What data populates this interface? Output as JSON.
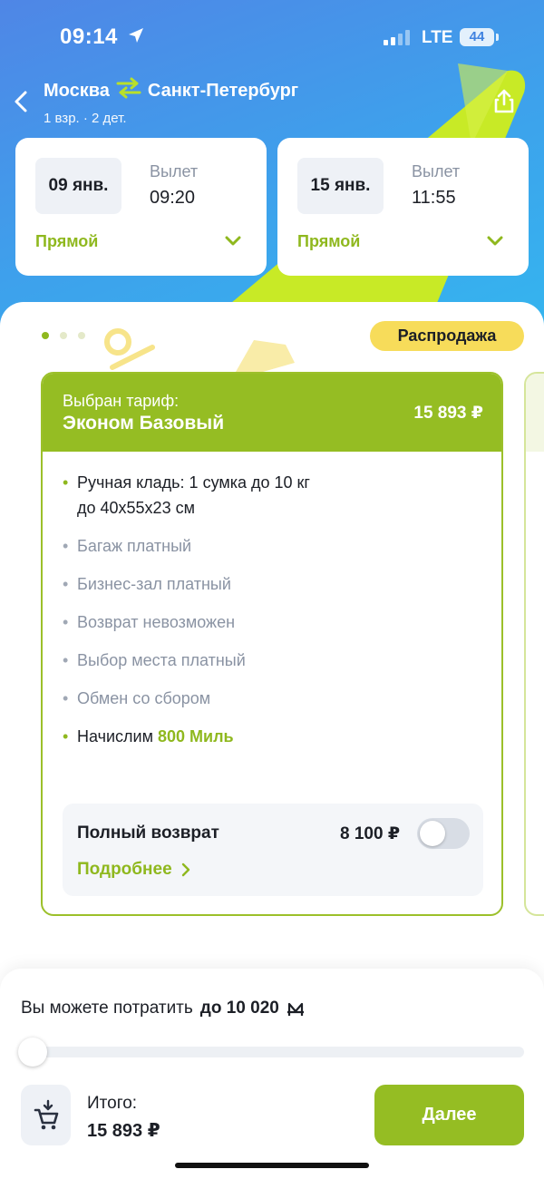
{
  "status_bar": {
    "time": "09:14",
    "network": "LTE",
    "battery": "44"
  },
  "header": {
    "from": "Москва",
    "to": "Санкт-Петербург",
    "passengers": "1 взр. · 2 дет."
  },
  "flights": [
    {
      "date": "09 янв.",
      "label": "Вылет",
      "time": "09:20",
      "type": "Прямой"
    },
    {
      "date": "15 янв.",
      "label": "Вылет",
      "time": "11:55",
      "type": "Прямой"
    }
  ],
  "carousel": {
    "page": 1,
    "total": 3
  },
  "sale_badge": "Распродажа",
  "tariff": {
    "selected_label": "Выбран тариф:",
    "name": "Эконом Базовый",
    "price": "15 893 ₽",
    "features": [
      {
        "line1": "Ручная кладь: 1 сумка до 10 кг",
        "line2": "до 40x55x23 см"
      },
      {
        "text": "Багаж платный"
      },
      {
        "text": "Бизнес-зал платный"
      },
      {
        "text": "Возврат невозможен"
      },
      {
        "text": "Выбор места платный"
      },
      {
        "text": "Обмен со сбором"
      }
    ],
    "miles_prefix": "Начислим",
    "miles": "800 Миль",
    "refund": {
      "title": "Полный возврат",
      "price": "8 100 ₽",
      "enabled": false,
      "more": "Подробнее"
    }
  },
  "bottom": {
    "spend_label": "Вы можете потратить",
    "spend_amount": "до 10 020",
    "slider_value": 0,
    "total_label": "Итого:",
    "total_value": "15 893 ₽",
    "next_button": "Далее"
  },
  "colors": {
    "accent": "#95bd23",
    "header_blue": "#3da2ec",
    "sale_yellow": "#f7dc5a"
  }
}
